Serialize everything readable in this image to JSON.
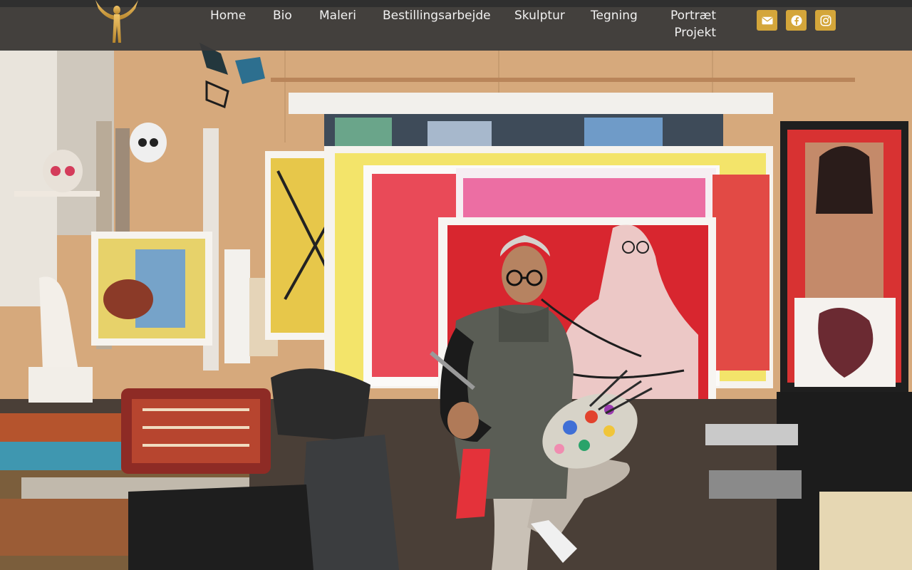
{
  "brand": {
    "logo_icon": "golden-winged-figure-logo",
    "accent_color": "#d4a63a"
  },
  "nav": {
    "items": [
      {
        "label": "Home"
      },
      {
        "label": "Bio"
      },
      {
        "label": "Maleri"
      },
      {
        "label": "Bestillingsarbejde"
      },
      {
        "label": "Skulptur"
      },
      {
        "label": "Tegning"
      },
      {
        "label": "Portræt Projekt"
      }
    ]
  },
  "social": [
    {
      "icon": "envelope-icon"
    },
    {
      "icon": "facebook-icon"
    },
    {
      "icon": "instagram-icon"
    }
  ],
  "hero": {
    "image_icon": "artist-studio-photo"
  }
}
